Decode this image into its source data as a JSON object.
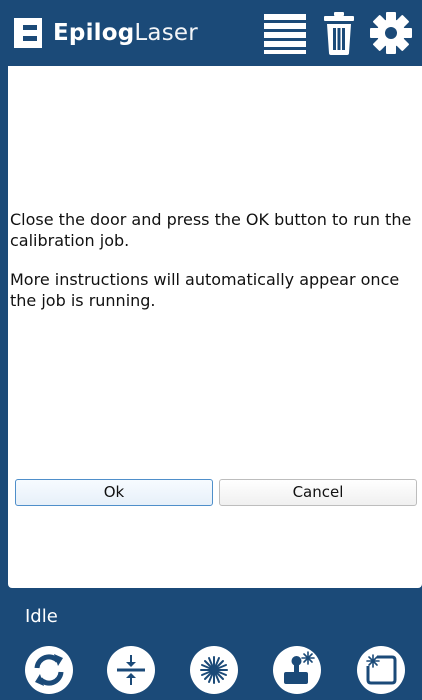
{
  "header": {
    "brand_bold": "Epilog",
    "brand_light": "Laser",
    "icons": [
      "job-list-icon",
      "trash-icon",
      "settings-gear-icon"
    ]
  },
  "dialog": {
    "message_line1": "Close the door and press the OK button to run the calibration job.",
    "message_line2": "More instructions will automatically appear once the job is running.",
    "ok_label": "Ok",
    "cancel_label": "Cancel"
  },
  "footer": {
    "status": "Idle",
    "buttons": [
      "refresh-icon",
      "focus-icon",
      "laser-fire-icon",
      "jog-icon",
      "home-corner-icon"
    ]
  },
  "colors": {
    "brand_blue": "#1b4a78",
    "ok_border": "#4f8fca"
  }
}
